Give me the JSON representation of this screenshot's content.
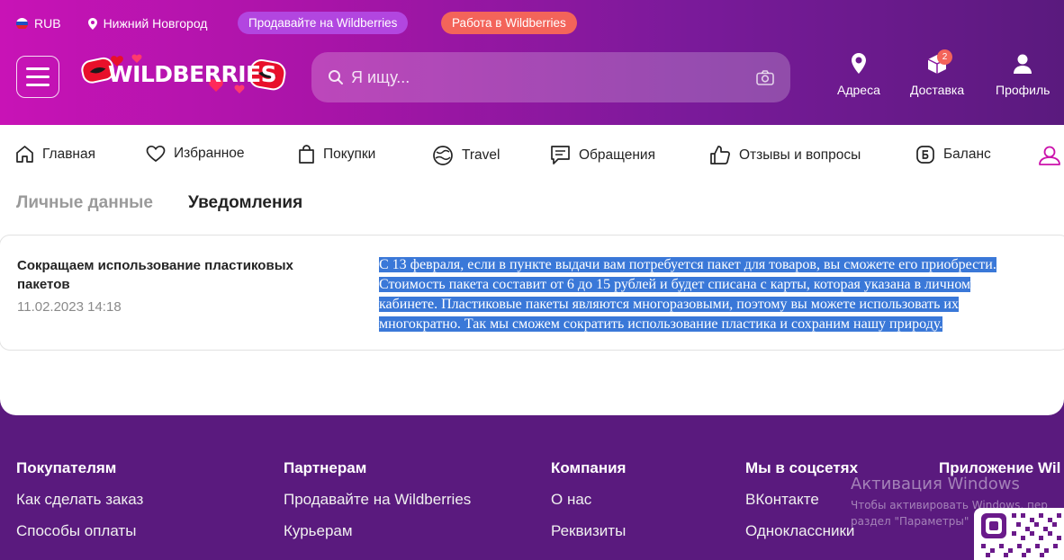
{
  "topbar": {
    "currency": "RUB",
    "city": "Нижний Новгород",
    "sell_pill": "Продавайте на Wildberries",
    "work_pill": "Работа в Wildberries"
  },
  "header": {
    "logo_text": "WILDBERRIES",
    "search_placeholder": "Я ищу...",
    "address_label": "Адреса",
    "delivery_label": "Доставка",
    "delivery_badge": "2",
    "profile_label": "Профиль"
  },
  "nav": {
    "tabs": [
      {
        "label": "Главная"
      },
      {
        "label": "Избранное"
      },
      {
        "label": "Покупки"
      },
      {
        "label": "Travel"
      },
      {
        "label": "Обращения"
      },
      {
        "label": "Отзывы и вопросы"
      },
      {
        "label": "Баланс"
      }
    ]
  },
  "subtabs": {
    "personal": "Личные данные",
    "notifications": "Уведомления"
  },
  "notification": {
    "title": "Сокращаем использование пластиковых пакетов",
    "date": "11.02.2023 14:18",
    "body": [
      "С 13 февраля, если в пункте выдачи вам потребуется пакет для товаров, вы сможете его приобрести.",
      "Стоимость пакета составит от 6 до 15 рублей и будет списана с карты, которая указана в личном",
      "кабинете. Пластиковые пакеты являются многоразовыми, поэтому вы можете использовать их",
      "многократно. Так мы сможем сократить использование пластика и сохраним нашу природу."
    ]
  },
  "footer": {
    "columns": [
      {
        "title": "Покупателям",
        "links": [
          "Как сделать заказ",
          "Способы оплаты"
        ]
      },
      {
        "title": "Партнерам",
        "links": [
          "Продавайте на Wildberries",
          "Курьерам"
        ]
      },
      {
        "title": "Компания",
        "links": [
          "О нас",
          "Реквизиты"
        ]
      },
      {
        "title": "Мы в соцсетях",
        "links": [
          "ВКонтакте",
          "Одноклассники"
        ]
      },
      {
        "title": "Приложение Wil",
        "links": []
      }
    ]
  },
  "activation": {
    "title": "Активация Windows",
    "line1": "Чтобы активировать Windows, пер",
    "line2": "раздел \"Параметры\""
  }
}
